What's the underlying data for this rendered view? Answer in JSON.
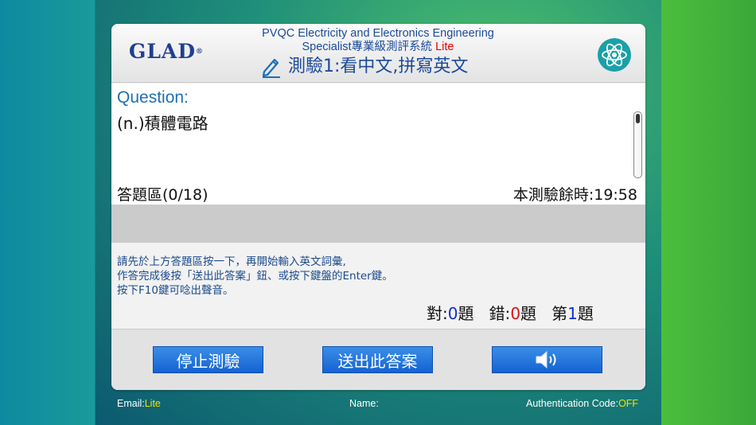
{
  "header": {
    "logo": "GLAD",
    "logo_mark": "®",
    "system_title_line1": "PVQC Electricity and Electronics Engineering",
    "system_title_line2": "Specialist專業級測評系統",
    "lite_tag": "Lite",
    "test_title": "測驗1:看中文,拼寫英文"
  },
  "question": {
    "label": "Question:",
    "text": "(n.)積體電路"
  },
  "answer": {
    "label": "答題區(0/18)",
    "timer": "本測驗餘時:19:58",
    "value": ""
  },
  "instructions": {
    "line1": "請先於上方答題區按一下，再開始輸入英文詞彙,",
    "line2": "作答完成後按「送出此答案」鈕、或按下鍵盤的Enter鍵。",
    "line3": "按下F10鍵可唸出聲音。"
  },
  "score": {
    "correct_label": "對:",
    "correct_count": "0",
    "wrong_label": "錯:",
    "wrong_count": "0",
    "question_prefix": "第",
    "question_number": "1",
    "unit": "題"
  },
  "buttons": {
    "stop": "停止測驗",
    "submit": "送出此答案",
    "sound_icon": "speaker-icon"
  },
  "footer": {
    "email_label": "Email:",
    "email_value": "Lite",
    "name_label": "Name:",
    "auth_label": "Authentication Code:",
    "auth_value": "OFF"
  },
  "colors": {
    "accent_blue": "#1b4a9a",
    "button_blue": "#1462d2",
    "lite_red": "#e00000",
    "footer_yellow": "#f6e300"
  }
}
